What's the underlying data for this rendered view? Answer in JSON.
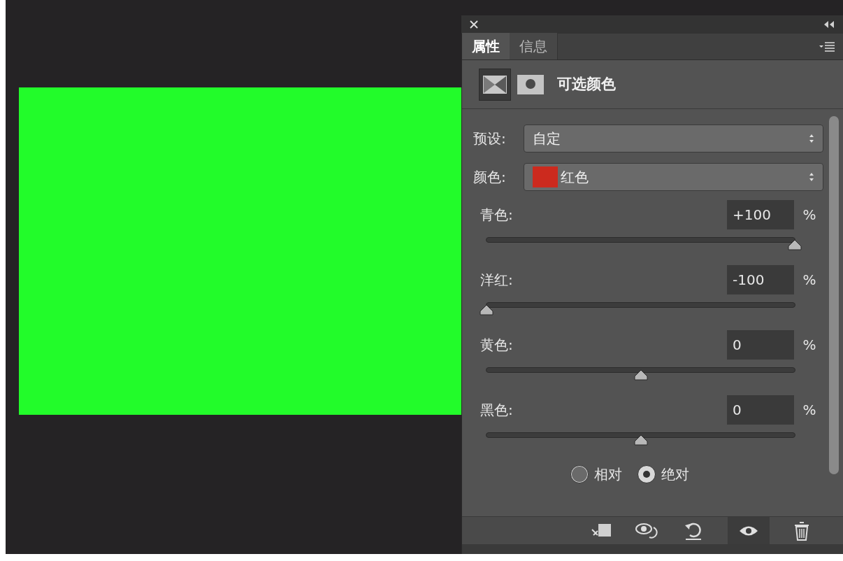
{
  "panel": {
    "tabs": [
      {
        "label": "属性",
        "selected": true
      },
      {
        "label": "信息",
        "selected": false
      }
    ],
    "title": "可选颜色",
    "preset": {
      "label": "预设:",
      "value": "自定"
    },
    "color": {
      "label": "颜色:",
      "value": "红色",
      "color": "#cc2a1e"
    },
    "sliders": [
      {
        "label": "青色:",
        "value": "+100",
        "unit": "%",
        "level": 1
      },
      {
        "label": "洋红:",
        "value": "-100",
        "unit": "%",
        "level": 0
      },
      {
        "label": "黄色:",
        "value": "0",
        "unit": "%",
        "level": 0.5
      },
      {
        "label": "黑色:",
        "value": "0",
        "unit": "%",
        "level": 0.5
      }
    ],
    "modes": [
      {
        "label": "相对",
        "selected": false
      },
      {
        "label": "绝对",
        "selected": true
      }
    ]
  }
}
